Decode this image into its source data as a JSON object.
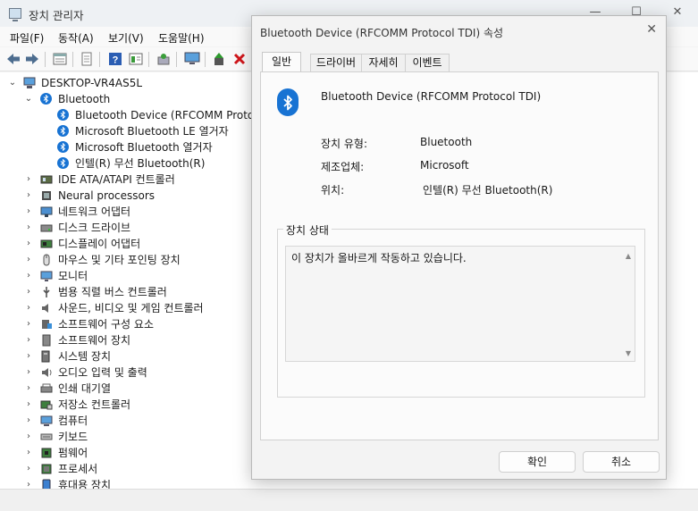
{
  "window": {
    "title": "장치 관리자",
    "controls": [
      "—",
      "☐",
      "✕"
    ]
  },
  "menu": [
    "파일(F)",
    "동작(A)",
    "보기(V)",
    "도움말(H)"
  ],
  "tree": {
    "root": "DESKTOP-VR4AS5L",
    "bluetooth_label": "Bluetooth",
    "bluetooth_children": [
      "Bluetooth Device (RFCOMM Protoco",
      "Microsoft Bluetooth LE 열거자",
      "Microsoft Bluetooth 열거자",
      "인텔(R) 무선 Bluetooth(R)"
    ],
    "categories": [
      {
        "label": "IDE ATA/ATAPI 컨트롤러",
        "icon": "ide-controller-icon"
      },
      {
        "label": "Neural processors",
        "icon": "neural-processor-icon"
      },
      {
        "label": "네트워크 어댑터",
        "icon": "network-adapter-icon"
      },
      {
        "label": "디스크 드라이브",
        "icon": "disk-drive-icon"
      },
      {
        "label": "디스플레이 어댑터",
        "icon": "display-adapter-icon"
      },
      {
        "label": "마우스 및 기타 포인팅 장치",
        "icon": "mouse-icon"
      },
      {
        "label": "모니터",
        "icon": "monitor-icon"
      },
      {
        "label": "범용 직렬 버스 컨트롤러",
        "icon": "usb-icon"
      },
      {
        "label": "사운드, 비디오 및 게임 컨트롤러",
        "icon": "speaker-icon"
      },
      {
        "label": "소프트웨어 구성 요소",
        "icon": "software-component-icon"
      },
      {
        "label": "소프트웨어 장치",
        "icon": "software-device-icon"
      },
      {
        "label": "시스템 장치",
        "icon": "system-device-icon"
      },
      {
        "label": "오디오 입력 및 출력",
        "icon": "audio-io-icon"
      },
      {
        "label": "인쇄 대기열",
        "icon": "printer-icon"
      },
      {
        "label": "저장소 컨트롤러",
        "icon": "storage-controller-icon"
      },
      {
        "label": "컴퓨터",
        "icon": "computer-icon"
      },
      {
        "label": "키보드",
        "icon": "keyboard-icon"
      },
      {
        "label": "펌웨어",
        "icon": "firmware-icon"
      },
      {
        "label": "프로세서",
        "icon": "processor-icon"
      },
      {
        "label": "휴대용 장치",
        "icon": "portable-device-icon"
      }
    ]
  },
  "dialog": {
    "title": "Bluetooth Device (RFCOMM Protocol TDI) 속성",
    "tabs": [
      "일반",
      "드라이버",
      "자세히",
      "이벤트"
    ],
    "active_tab": "일반",
    "device_name": "Bluetooth Device (RFCOMM Protocol TDI)",
    "props": [
      {
        "label": "장치 유형:",
        "value": "Bluetooth"
      },
      {
        "label": "제조업체:",
        "value": "Microsoft"
      },
      {
        "label": "위치:",
        "value": "인텔(R) 무선 Bluetooth(R)"
      }
    ],
    "status_group": "장치 상태",
    "status_text": "이 장치가 올바르게 작동하고 있습니다.",
    "ok": "확인",
    "cancel": "취소"
  },
  "colors": {
    "bluetooth_blue": "#1873d3",
    "window_bg": "#f3f3f3",
    "tree_bg": "#ffffff"
  }
}
